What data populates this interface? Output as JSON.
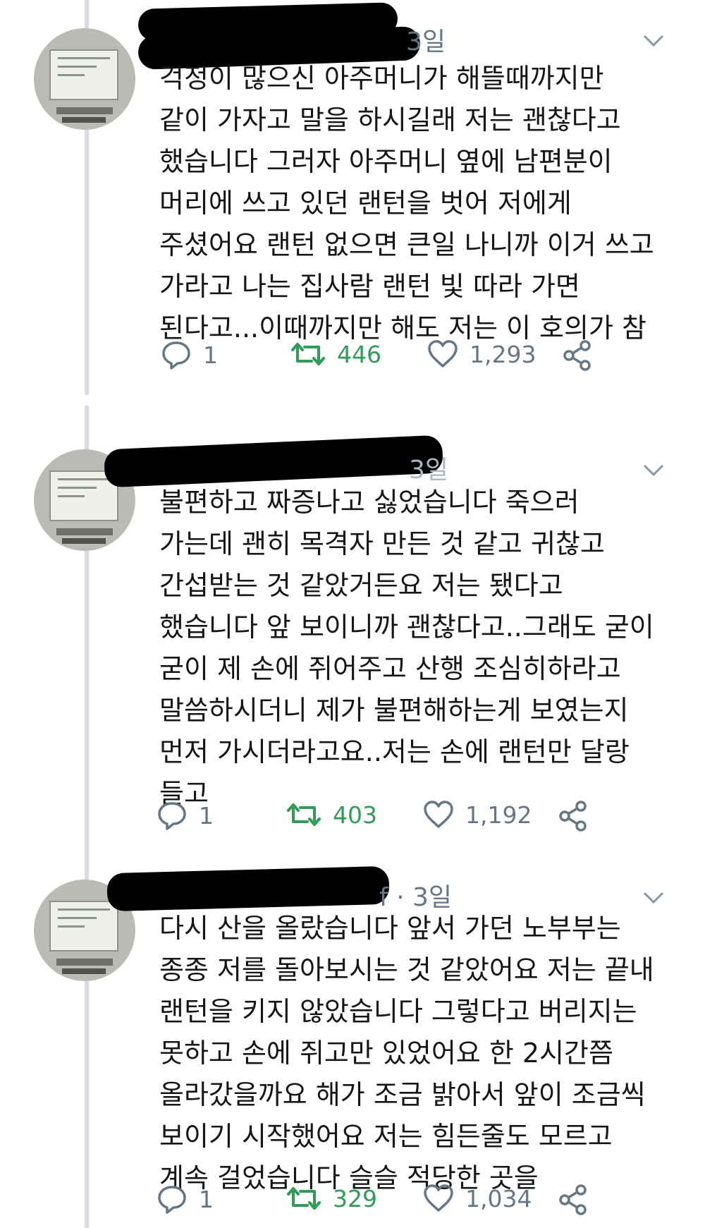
{
  "tweets": [
    {
      "time": "3일",
      "text": "걱정이 많으신 아주머니가 해뜰때까지만\n같이 가자고 말을 하시길래 저는 괜찮다고\n했습니다 그러자 아주머니 옆에 남편분이\n머리에 쓰고 있던 랜턴을 벗어 저에게\n주셨어요 랜턴 없으면 큰일 나니까 이거 쓰고\n가라고 나는 집사람 랜턴 빛 따라 가면\n된다고...이때까지만 해도 저는 이 호의가 참",
      "replies": "1",
      "retweets": "446",
      "likes": "1,293"
    },
    {
      "time": "3일",
      "text": "불편하고 짜증나고 싫었습니다 죽으러\n가는데 괜히 목격자 만든 것 같고 귀찮고\n간섭받는 것 같았거든요 저는 됐다고\n했습니다 앞 보이니까 괜찮다고..그래도 굳이\n굳이 제 손에 쥐어주고 산행 조심히하라고\n말씀하시더니 제가 불편해하는게 보였는지\n먼저 가시더라고요..저는 손에 랜턴만 달랑\n들고",
      "replies": "1",
      "retweets": "403",
      "likes": "1,192"
    },
    {
      "time": "f · 3일",
      "text": "다시 산을 올랐습니다 앞서 가던 노부부는\n종종 저를 돌아보시는 것 같았어요 저는 끝내\n랜턴을 키지 않았습니다 그렇다고 버리지는\n못하고 손에 쥐고만 있었어요 한 2시간쯤\n올라갔을까요 해가 조금 밝아서 앞이 조금씩\n보이기 시작했어요 저는 힘든줄도 모르고\n계속 걸었습니다 슬슬 적당한 곳을",
      "replies": "1",
      "retweets": "329",
      "likes": "1,034"
    }
  ],
  "colors": {
    "retweet": "#2e9e57",
    "muted": "#657786",
    "thread": "#d8dde3"
  },
  "icons": [
    "reply-icon",
    "retweet-icon",
    "like-icon",
    "share-icon",
    "chevron-down-icon"
  ]
}
